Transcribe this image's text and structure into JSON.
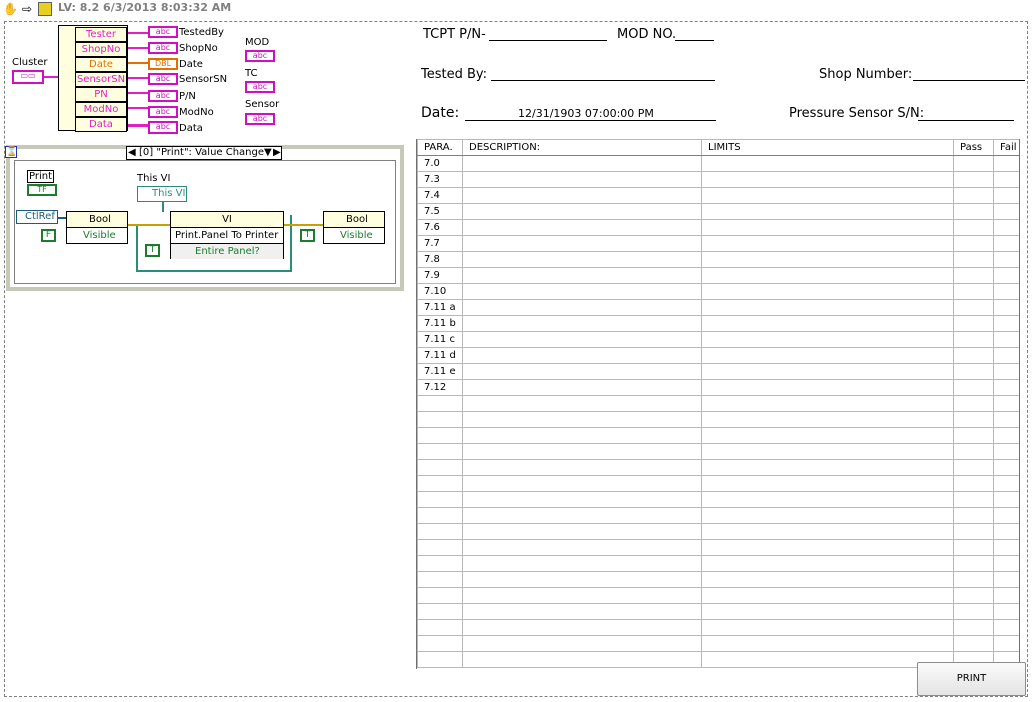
{
  "toolbar": {
    "title": "LV: 8.2 6/3/2013 8:03:32 AM"
  },
  "diagram": {
    "cluster_label": "Cluster",
    "unbundle_fields": [
      "Tester",
      "ShopNo",
      "Date",
      "SensorSN",
      "PN",
      "ModNo",
      "Data"
    ],
    "indicators": [
      "TestedBy",
      "ShopNo",
      "Date",
      "SensorSN",
      "P/N",
      "ModNo",
      "Data"
    ],
    "extra_labels": [
      "MOD",
      "TC",
      "Sensor"
    ],
    "type_abc": "abc",
    "type_dbl": "DBL",
    "event_selector": "[0] \"Print\": Value Change",
    "print_label": "Print",
    "print_tf": "TF",
    "ctlref": "CtlRef",
    "bool_node_label": "Bool",
    "visible_label": "Visible",
    "false_const": "F",
    "true_const": "T",
    "this_vi_caption": "This VI",
    "this_vi_box": "This VI",
    "vi_node_label": "VI",
    "print_panel": "Print.Panel To Printer",
    "entire_panel": "Entire Panel?"
  },
  "front_panel": {
    "tcpt_pn": "TCPT P/N-",
    "mod_no": "MOD NO.",
    "tested_by": "Tested By:",
    "shop_number": "Shop Number:",
    "date_label": "Date:",
    "date_value": "12/31/1903 07:00:00 PM",
    "pressure_sensor": "Pressure Sensor S/N:"
  },
  "table": {
    "headers": [
      "PARA.",
      "DESCRIPTION:",
      "LIMITS",
      "Pass",
      "Fail"
    ],
    "rows": [
      "7.0",
      "7.3",
      "7.4",
      "7.5",
      "7.6",
      "7.7",
      "7.8",
      "7.9",
      "7.10",
      "7.11 a",
      "7.11 b",
      "7.11 c",
      "7.11 d",
      "7.11 e",
      "7.12"
    ],
    "empty_rows": 17
  },
  "print_button": "PRINT"
}
